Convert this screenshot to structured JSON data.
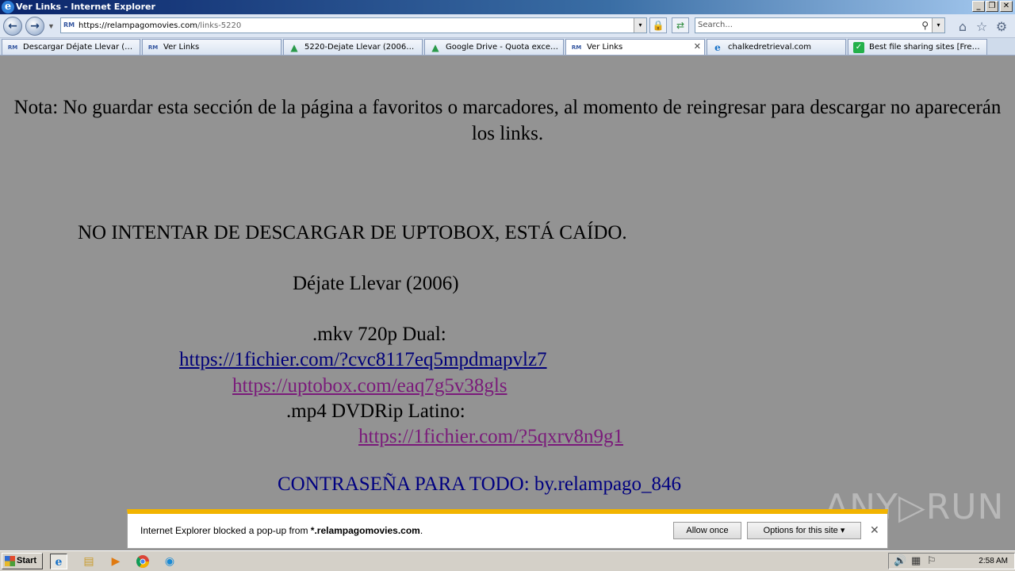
{
  "window": {
    "title": "Ver Links - Internet Explorer",
    "minimize": "_",
    "restore": "❐",
    "close": "✕"
  },
  "address": {
    "favicon": "RM",
    "url_host": "https://relampagomovies.com",
    "url_path": "/links-5220",
    "dropdown": "▾"
  },
  "search": {
    "placeholder": "Search...",
    "dropdown": "▾"
  },
  "tabs": [
    {
      "icon": "RM",
      "label": "Descargar Déjate Llevar (2..."
    },
    {
      "icon": "RM",
      "label": "Ver Links"
    },
    {
      "icon": "▲",
      "label": "5220-Dejate Llevar (2006) ..."
    },
    {
      "icon": "▲",
      "label": "Google Drive - Quota excee..."
    },
    {
      "icon": "RM",
      "label": "Ver Links",
      "close": "✕"
    },
    {
      "icon": "e",
      "label": "chalkedretrieval.com"
    },
    {
      "icon": "✓",
      "label": "Best file sharing sites [Free..."
    }
  ],
  "page": {
    "note": "Nota: No guardar esta sección de la página a favoritos o marcadores, al momento de reingresar para descargar no aparecerán los links.",
    "warning": "NO INTENTAR DE DESCARGAR DE UPTOBOX, ESTÁ CAÍDO.",
    "movie_title": "Déjate Llevar (2006)",
    "format1": ".mkv 720p Dual:",
    "link1": "https://1fichier.com/?cvc8117eq5mpdmapvlz7",
    "link2": "https://uptobox.com/eaq7g5v38gls",
    "format2": ".mp4 DVDRip Latino:",
    "link3": "https://1fichier.com/?5qxrv8n9g1",
    "password": "CONTRASEÑA PARA TODO: by.relampago_846"
  },
  "watermark": "ANY▷RUN",
  "notification": {
    "msg_prefix": "Internet Explorer blocked a pop-up from ",
    "msg_site": "*.relampagomovies.com",
    "msg_suffix": ".",
    "allow_once": "Allow once",
    "options": "Options for this site ▾",
    "close": "✕"
  },
  "taskbar": {
    "start": "Start",
    "clock": "2:58 AM"
  },
  "icons": {
    "back": "←",
    "forward": "→",
    "lock": "🔒",
    "refresh": "⇄",
    "search": "⚲",
    "home": "⌂",
    "favorites": "☆",
    "tools": "⚙"
  }
}
